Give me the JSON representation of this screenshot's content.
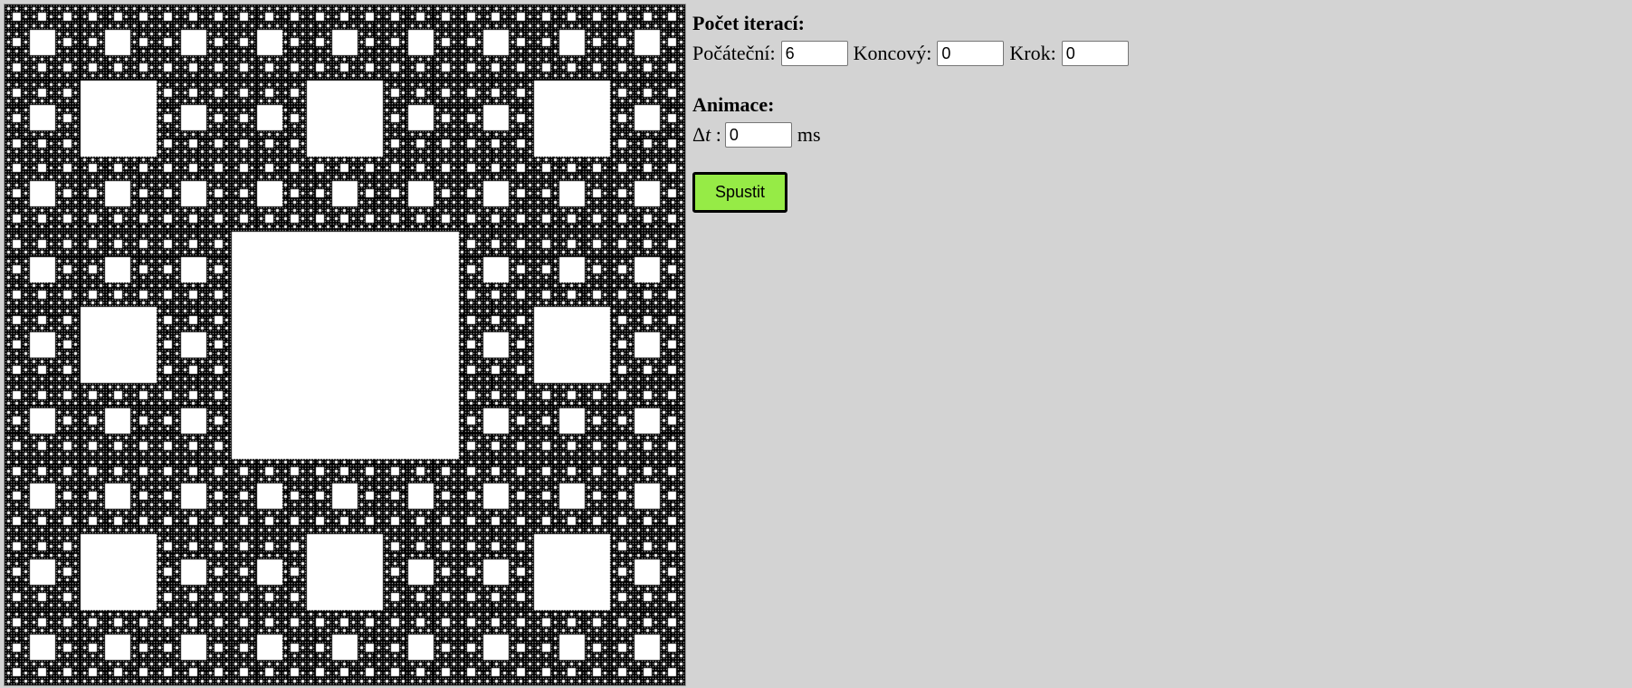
{
  "iterations": {
    "title": "Počet iterací:",
    "start_label": "Počáteční:",
    "start_value": "6",
    "end_label": "Koncový:",
    "end_value": "0",
    "step_label": "Krok:",
    "step_value": "0"
  },
  "animation": {
    "title": "Animace:",
    "delta_symbol": "Δ",
    "delta_var": "t",
    "delta_colon": ":",
    "dt_value": "0",
    "unit": "ms"
  },
  "run_button_label": "Spustit",
  "fractal": {
    "name": "sierpinski-carpet",
    "fill_color": "#000000",
    "hole_color": "#ffffff",
    "displayed_depth": 6
  },
  "colors": {
    "background": "#d3d3d3",
    "button": "#96eb46"
  }
}
